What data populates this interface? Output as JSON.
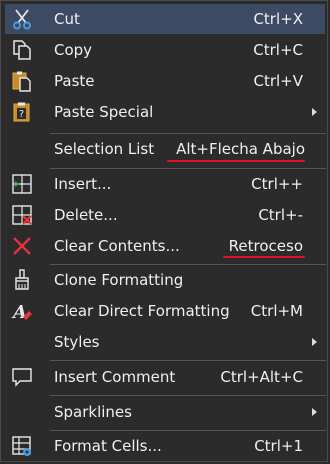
{
  "menu": {
    "cut": {
      "label": "Cut",
      "shortcut": "Ctrl+X"
    },
    "copy": {
      "label": "Copy",
      "shortcut": "Ctrl+C"
    },
    "paste": {
      "label": "Paste",
      "shortcut": "Ctrl+V"
    },
    "paste_special": {
      "label": "Paste Special"
    },
    "selection_list": {
      "label": "Selection List",
      "shortcut": "Alt+Flecha Abajo"
    },
    "insert": {
      "label": "Insert...",
      "shortcut": "Ctrl++"
    },
    "delete": {
      "label": "Delete...",
      "shortcut": "Ctrl+-"
    },
    "clear_contents": {
      "label": "Clear Contents...",
      "shortcut": "Retroceso"
    },
    "clone_formatting": {
      "label": "Clone Formatting"
    },
    "clear_direct_formatting": {
      "label": "Clear Direct Formatting",
      "shortcut": "Ctrl+M"
    },
    "styles": {
      "label": "Styles"
    },
    "insert_comment": {
      "label": "Insert Comment",
      "shortcut": "Ctrl+Alt+C"
    },
    "sparklines": {
      "label": "Sparklines"
    },
    "format_cells": {
      "label": "Format Cells...",
      "shortcut": "Ctrl+1"
    }
  },
  "colors": {
    "background": "#2b2b2b",
    "highlight": "#3c4a63",
    "annotation": "#e0102a"
  }
}
